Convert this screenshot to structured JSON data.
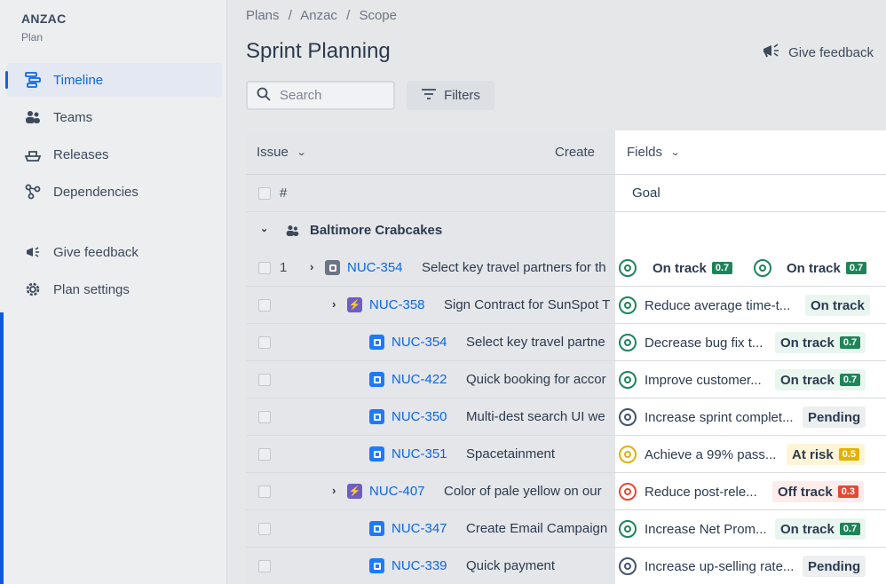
{
  "project": {
    "name": "ANZAC",
    "type": "Plan"
  },
  "nav": {
    "items": [
      {
        "label": "Timeline",
        "icon": "timeline-icon",
        "active": true
      },
      {
        "label": "Teams",
        "icon": "teams-icon"
      },
      {
        "label": "Releases",
        "icon": "releases-icon"
      },
      {
        "label": "Dependencies",
        "icon": "dependencies-icon"
      }
    ],
    "secondary": [
      {
        "label": "Give feedback",
        "icon": "megaphone-icon"
      },
      {
        "label": "Plan settings",
        "icon": "gear-icon"
      }
    ]
  },
  "breadcrumb": [
    "Plans",
    "/",
    "Anzac",
    "/",
    "Scope"
  ],
  "page": {
    "title": "Sprint Planning",
    "feedback_label": "Give feedback"
  },
  "toolbar": {
    "search_placeholder": "Search",
    "filters_label": "Filters"
  },
  "table": {
    "header": {
      "issue": "Issue",
      "create": "Create",
      "fields": "Fields"
    },
    "subheader": {
      "hash": "#",
      "goal": "Goal"
    },
    "group": {
      "label": "Baltimore Crabcakes"
    },
    "rows": [
      {
        "rank": "1",
        "key": "NUC-354",
        "summary": "Select key travel partners for th",
        "goal": "",
        "status": "On track",
        "score": "0.7",
        "status2": "On track",
        "score2": "0.7"
      },
      {
        "rank": "",
        "key": "NUC-358",
        "summary": "Sign Contract for SunSpot T",
        "goal": "Reduce average time-t...",
        "status": "On track",
        "score": ""
      },
      {
        "rank": "",
        "key": "NUC-354",
        "summary": "Select key travel partne",
        "goal": "Decrease bug fix t...",
        "status": "On track",
        "score": "0.7"
      },
      {
        "rank": "",
        "key": "NUC-422",
        "summary": "Quick booking for accor",
        "goal": "Improve customer...",
        "status": "On track",
        "score": "0.7"
      },
      {
        "rank": "",
        "key": "NUC-350",
        "summary": "Multi-dest search UI we",
        "goal": "Increase sprint complet...",
        "status": "Pending",
        "score": ""
      },
      {
        "rank": "",
        "key": "NUC-351",
        "summary": "Spacetainment",
        "goal": "Achieve a 99% pass...",
        "status": "At risk",
        "score": "0.5"
      },
      {
        "rank": "",
        "key": "NUC-407",
        "summary": "Color of pale yellow on our",
        "goal": "Reduce post-rele...",
        "status": "Off track",
        "score": "0.3"
      },
      {
        "rank": "",
        "key": "NUC-347",
        "summary": "Create Email Campaign",
        "goal": "Increase Net Prom...",
        "status": "On track",
        "score": "0.7"
      },
      {
        "rank": "",
        "key": "NUC-339",
        "summary": "Quick payment",
        "goal": "Increase up-selling rate...",
        "status": "Pending",
        "score": ""
      }
    ]
  },
  "colors": {
    "accent": "#0c66e4",
    "on_track": "#1f845a",
    "at_risk": "#e2b203",
    "off_track": "#e34935",
    "pending": "#44546f"
  }
}
